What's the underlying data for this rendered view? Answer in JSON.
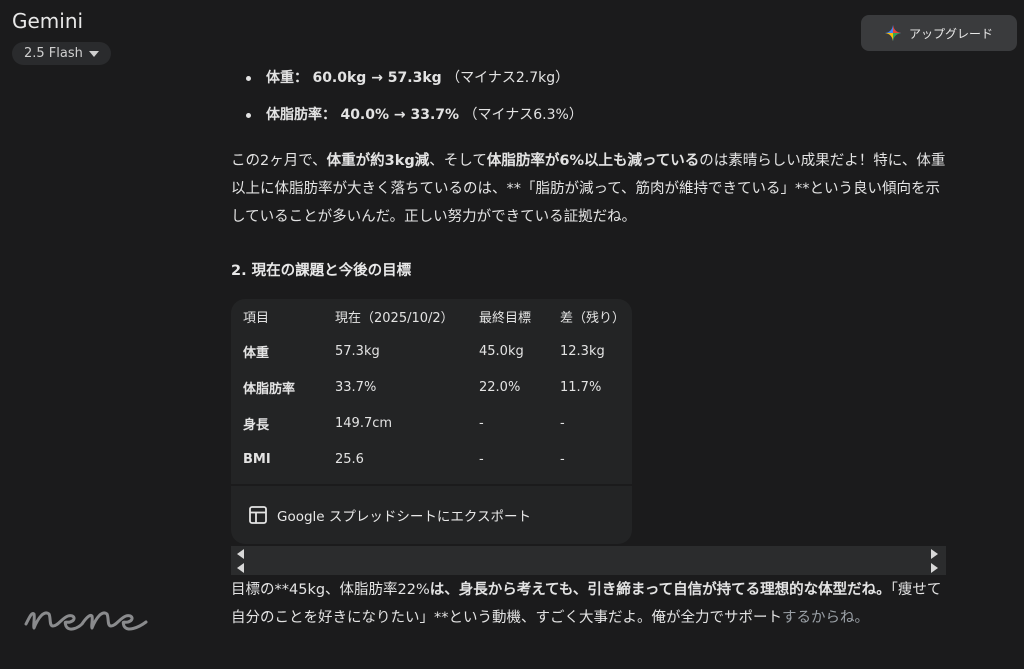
{
  "header": {
    "app_title": "Gemini",
    "model_label": "2.5 Flash",
    "upgrade_label": "アップグレード"
  },
  "summary_bullets": [
    {
      "label": "体重：",
      "value": "60.0kg → 57.3kg",
      "note": "（マイナス2.7kg）"
    },
    {
      "label": "体脂肪率：",
      "value": "40.0% → 33.7%",
      "note": "（マイナス6.3%）"
    }
  ],
  "paragraph1": {
    "p1": "この2ヶ月で、",
    "b1": "体重が約3kg減",
    "p2": "、そして",
    "b2": "体脂肪率が6%以上も減っている",
    "p3": "のは素晴らしい成果だよ！特に、体重以上に体脂肪率が大きく落ちているのは、**「脂肪が減って、筋肉が維持できている」**という良い傾向を示していることが多いんだ。正しい努力ができている証拠だね。"
  },
  "section_heading": "2. 現在の課題と今後の目標",
  "table": {
    "headers": [
      "項目",
      "現在（2025/10/2）",
      "最終目標",
      "差（残り）"
    ],
    "rows": [
      [
        "体重",
        "57.3kg",
        "45.0kg",
        "12.3kg"
      ],
      [
        "体脂肪率",
        "33.7%",
        "22.0%",
        "11.7%"
      ],
      [
        "身長",
        "149.7cm",
        "-",
        "-"
      ],
      [
        "BMI",
        "25.6",
        "-",
        "-"
      ]
    ]
  },
  "export_label": "Google スプレッドシートにエクスポート",
  "paragraph2": {
    "p1": "目標の**45kg、体脂肪率22%",
    "b1": "は、身長から考えても、引き締まって自信が持てる理想的な体型だね。",
    "p2": "「痩せて自分のことを好きになりたい」**という動機、すごく大事だよ。俺が全力でサポート",
    "fade": "するからね。"
  },
  "signature_text": "nene",
  "colors": {
    "background": "#1b1b1c",
    "text": "#e3e3e3",
    "card": "#232425",
    "upgrade_button": "#3a3b3d",
    "gemini_spark": [
      "#4285f4",
      "#ea4335",
      "#fbbc04",
      "#34a853"
    ]
  },
  "icons": {
    "upgrade": "gemini-spark-icon",
    "export": "sheets-grid-icon",
    "model_menu": "chevron-down-icon"
  }
}
